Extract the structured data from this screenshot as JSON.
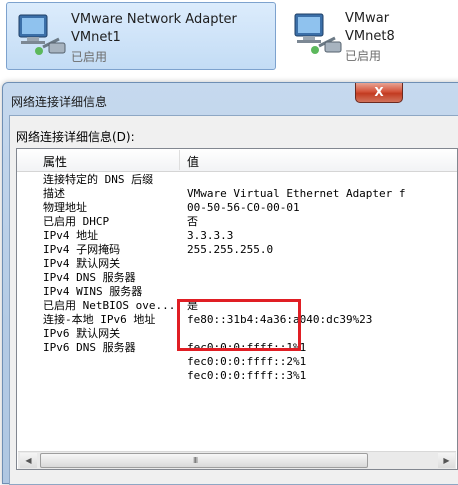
{
  "adapters": [
    {
      "name": "VMware Network Adapter",
      "network": "VMnet1",
      "status": "已启用"
    },
    {
      "name": "VMwar",
      "network": "VMnet8",
      "status": "已启用"
    }
  ],
  "dialog": {
    "title": "网络连接详细信息",
    "close_label": "X",
    "list_label": "网络连接详细信息(D):",
    "columns": {
      "property": "属性",
      "value": "值"
    },
    "rows": [
      {
        "prop": "连接特定的 DNS 后缀",
        "val": ""
      },
      {
        "prop": "描述",
        "val": "VMware Virtual Ethernet Adapter f"
      },
      {
        "prop": "物理地址",
        "val": "00-50-56-C0-00-01"
      },
      {
        "prop": "已启用 DHCP",
        "val": "否"
      },
      {
        "prop": "IPv4 地址",
        "val": "3.3.3.3"
      },
      {
        "prop": "IPv4 子网掩码",
        "val": "255.255.255.0"
      },
      {
        "prop": "IPv4 默认网关",
        "val": ""
      },
      {
        "prop": "IPv4 DNS 服务器",
        "val": ""
      },
      {
        "prop": "IPv4 WINS 服务器",
        "val": ""
      },
      {
        "prop": "已启用 NetBIOS ove...",
        "val": "是"
      },
      {
        "prop": "连接-本地 IPv6 地址",
        "val": "fe80::31b4:4a36:a040:dc39%23"
      },
      {
        "prop": "IPv6 默认网关",
        "val": ""
      },
      {
        "prop": "IPv6 DNS 服务器",
        "val": "fec0:0:0:ffff::1%1"
      },
      {
        "prop": "",
        "val": "fec0:0:0:ffff::2%1"
      },
      {
        "prop": "",
        "val": "fec0:0:0:ffff::3%1"
      }
    ],
    "scroll_grip": "III"
  },
  "colors": {
    "selection": "#c3dcf5",
    "highlight": "#e01e24"
  },
  "icons": [
    "network-adapter-icon",
    "close-icon",
    "scroll-left-icon",
    "scroll-right-icon"
  ]
}
